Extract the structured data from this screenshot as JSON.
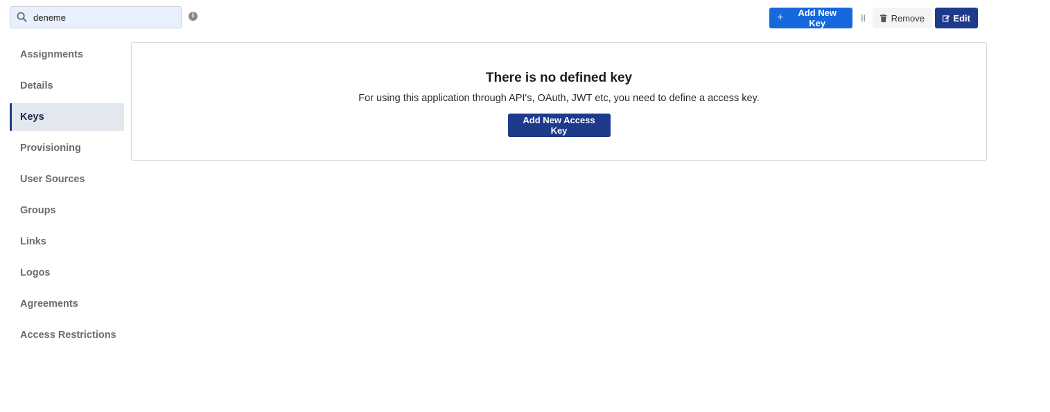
{
  "search": {
    "value": "deneme",
    "placeholder": ""
  },
  "toolbar": {
    "add_key_label": "Add New Key",
    "remove_label": "Remove",
    "edit_label": "Edit"
  },
  "sidebar": {
    "items": [
      {
        "label": "Assignments"
      },
      {
        "label": "Details"
      },
      {
        "label": "Keys",
        "active": true
      },
      {
        "label": "Provisioning"
      },
      {
        "label": "User Sources"
      },
      {
        "label": "Groups"
      },
      {
        "label": "Links"
      },
      {
        "label": "Logos"
      },
      {
        "label": "Agreements"
      },
      {
        "label": "Access Restrictions"
      }
    ]
  },
  "empty_state": {
    "title": "There is no defined key",
    "description": "For using this application through API's, OAuth, JWT etc, you need to define a access key.",
    "button_label": "Add New Access Key"
  },
  "colors": {
    "primary_blue": "#1668dc",
    "navy": "#1e3a8a",
    "active_bg": "#e3e7ee",
    "search_bg": "#e8f0fe"
  }
}
